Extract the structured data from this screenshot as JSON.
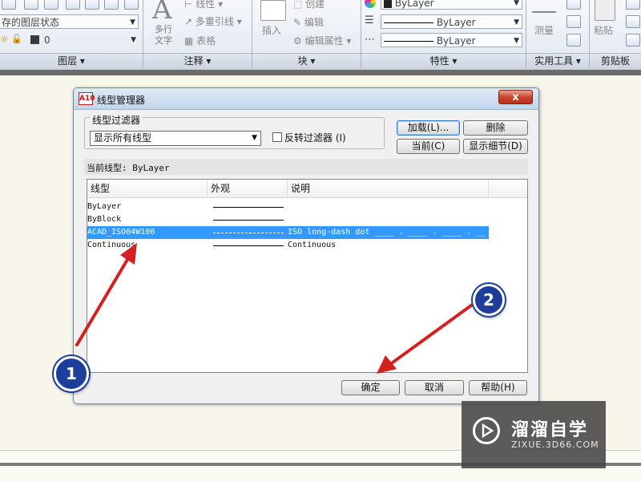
{
  "ribbon": {
    "layer_state": "存的图层状态",
    "layer_name": "0",
    "annotation": {
      "multiline_text": "多行文字",
      "linear": "线性",
      "multileader": "多重引线",
      "table": "表格"
    },
    "block": {
      "insert": "插入",
      "create": "创建",
      "edit": "编辑",
      "edit_attributes": "编辑属性"
    },
    "properties": {
      "color": "ByLayer",
      "linetype": "ByLayer",
      "lineweight": "ByLayer"
    },
    "utilities": {
      "measure": "测量"
    },
    "clipboard": {
      "paste": "粘贴"
    },
    "panels": [
      "图层 ▾",
      "注释 ▾",
      "块 ▾",
      "特性 ▾",
      "实用工具 ▾",
      "剪贴板"
    ]
  },
  "dialog": {
    "icon_text": "A10",
    "title": "线型管理器",
    "close_symbol": "x",
    "filter_label": "线型过滤器",
    "filter_value": "显示所有线型",
    "invert_label": "反转过滤器 (I)",
    "buttons": {
      "load": "加载(L)...",
      "delete": "删除",
      "current": "当前(C)",
      "details": "显示细节(D)",
      "ok": "确定",
      "cancel": "取消",
      "help": "帮助(H)"
    },
    "current_linetype": "当前线型:  ByLayer",
    "columns": [
      "线型",
      "外观",
      "说明"
    ],
    "rows": [
      {
        "name": "ByLayer",
        "desc": ""
      },
      {
        "name": "ByBlock",
        "desc": ""
      },
      {
        "name": "ACAD_ISO04W100",
        "desc": "ISO long-dash dot ____ . ____ . ____ . __"
      },
      {
        "name": "Continuous",
        "desc": "Continuous"
      }
    ]
  },
  "annotations": {
    "marker1": "1",
    "marker2": "2"
  },
  "watermark": {
    "title": "溜溜自学",
    "url": "ZIXUE.3D66.COM"
  },
  "colors": {
    "selection": "#3399ff",
    "marker": "#1d3f9b",
    "arrow": "#d42020"
  }
}
